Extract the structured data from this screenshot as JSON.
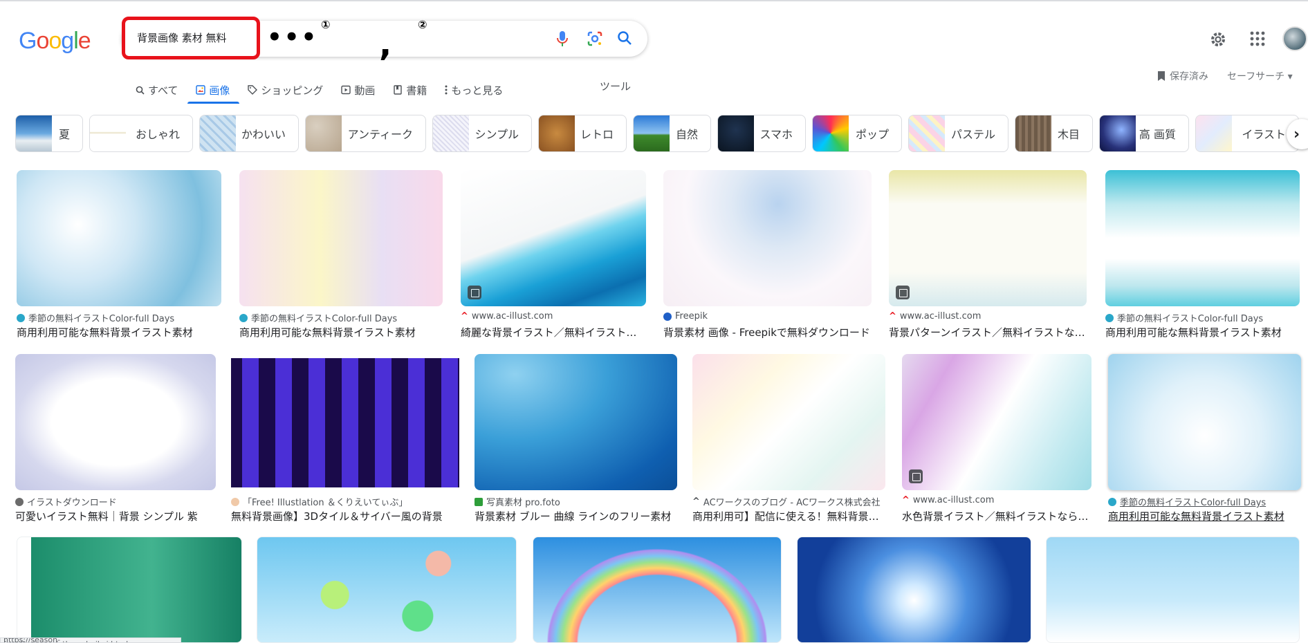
{
  "logo": {
    "text": "Google"
  },
  "search": {
    "query": "背景画像 素材 無料"
  },
  "annotation": {
    "dots": "•••",
    "mark1": "①",
    "comma": ",",
    "mark2": "②"
  },
  "tabs": [
    {
      "label": "すべて",
      "icon": "search-icon"
    },
    {
      "label": "画像",
      "icon": "image-icon"
    },
    {
      "label": "ショッピング",
      "icon": "tag-icon"
    },
    {
      "label": "動画",
      "icon": "play-icon"
    },
    {
      "label": "書籍",
      "icon": "book-icon"
    },
    {
      "label": "もっと見る",
      "icon": "more-vert-icon"
    }
  ],
  "tools_label": "ツール",
  "header_right": {
    "saved": "保存済み",
    "safesearch": "セーフサーチ ▾"
  },
  "chips": [
    {
      "label": "夏"
    },
    {
      "label": "おしゃれ"
    },
    {
      "label": "かわいい"
    },
    {
      "label": "アンティーク"
    },
    {
      "label": "シンプル"
    },
    {
      "label": "レトロ"
    },
    {
      "label": "自然"
    },
    {
      "label": "スマホ"
    },
    {
      "label": "ポップ"
    },
    {
      "label": "パステル"
    },
    {
      "label": "木目"
    },
    {
      "label": "高 画質"
    },
    {
      "label": "イラスト"
    }
  ],
  "results": [
    {
      "source": "季節の無料イラストColor-full Days",
      "title": "商用利用可能な無料背景イラスト素材"
    },
    {
      "source": "季節の無料イラストColor-full Days",
      "title": "商用利用可能な無料背景イラスト素材"
    },
    {
      "source": "www.ac-illust.com",
      "title": "綺麗な背景イラスト／無料イラストなら「イ"
    },
    {
      "source": "Freepik",
      "title": "背景素材 画像 - Freepikで無料ダウンロード"
    },
    {
      "source": "www.ac-illust.com",
      "title": "背景パターンイラスト／無料イラストなら「"
    },
    {
      "source": "季節の無料イラストColor-full Days",
      "title": "商用利用可能な無料背景イラスト素材"
    },
    {
      "source": "イラストダウンロード",
      "title": "可愛いイラスト無料｜背景 シンプル 紫"
    },
    {
      "source": "「Free! Illustlation ＆くりえいてぃぶ」",
      "title": "無料背景画像】3Dタイル＆サイバー風の背景"
    },
    {
      "source": "写真素材 pro.foto",
      "title": "背景素材 ブルー 曲線 ラインのフリー素材"
    },
    {
      "source": "ACワークスのブログ - ACワークス株式会社",
      "title": "商用利用可】配信に使える！無料背景素材"
    },
    {
      "source": "www.ac-illust.com",
      "title": "水色背景イラスト／無料イラストなら「イ"
    },
    {
      "source": "季節の無料イラストColor-full Days",
      "title": "商用利用可能な無料背景イラスト素材"
    }
  ],
  "status_url": "https://season-freeillust.com/others_haikei.html",
  "colors": {
    "accent": "#1a73e8",
    "highlight": "#e8121b"
  }
}
